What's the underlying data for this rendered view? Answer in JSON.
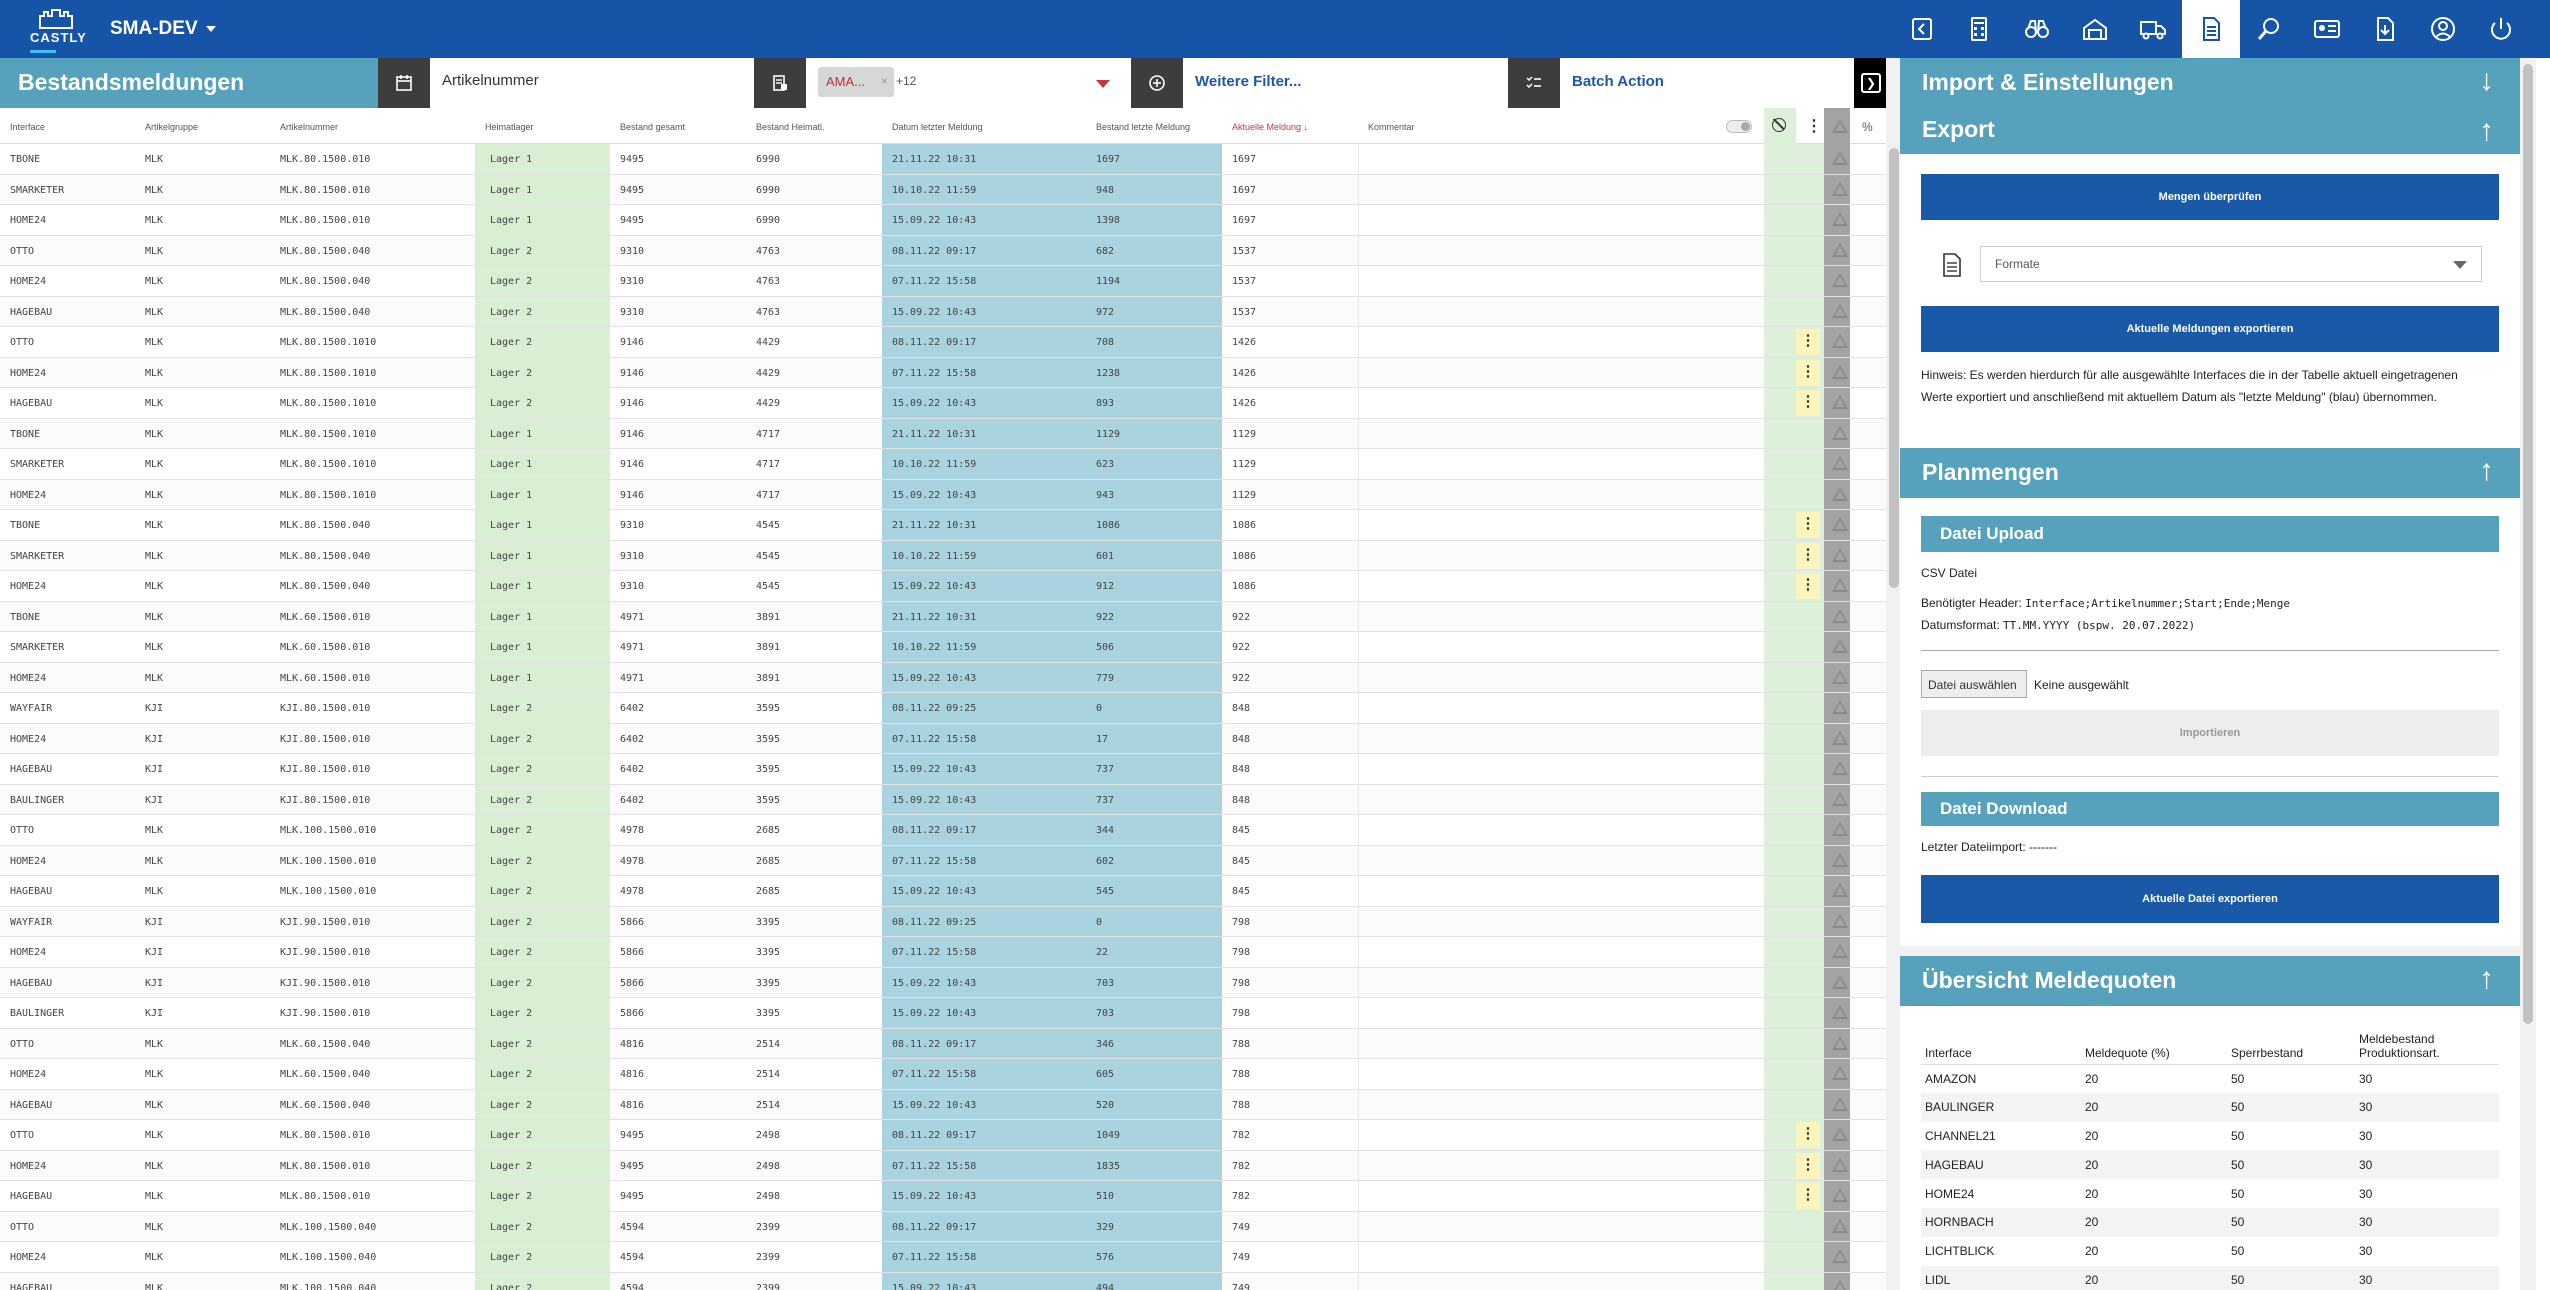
{
  "app": {
    "logo_text": "CASTLY",
    "name": "SMA-DEV"
  },
  "nav_icons": [
    "sign-out-left-icon",
    "calculator-icon",
    "binoculars-icon",
    "warehouse-icon",
    "truck-icon",
    "document-icon",
    "search-zoom-icon",
    "id-card-icon",
    "document-download-icon",
    "user-icon",
    "power-icon"
  ],
  "toolbar": {
    "title": "Bestandsmeldungen",
    "article_placeholder": "Artikelnummer",
    "chip_label": "AMA...",
    "chip_remove": "×",
    "chip_more": "+12",
    "more_filters": "Weitere Filter...",
    "batch_action": "Batch Action"
  },
  "columns": {
    "interface": "Interface",
    "group": "Artikelgruppe",
    "article": "Artikelnummer",
    "lager": "Heimatlager",
    "stock_total": "Bestand gesamt",
    "stock_home": "Bestand Heimatl.",
    "last_date": "Datum letzter Meldung",
    "last_stock": "Bestand letzte Meldung",
    "current": "Aktuelle Meldung ↓",
    "comment": "Kommentar",
    "percent": "%"
  },
  "rows": [
    {
      "i": "TBONE",
      "g": "MLK",
      "a": "MLK.80.1500.010",
      "l": "Lager 1",
      "t": "9495",
      "h": "6990",
      "d": "21.11.22 10:31",
      "s": "1697",
      "c": "1697",
      "dots": false
    },
    {
      "i": "SMARKETER",
      "g": "MLK",
      "a": "MLK.80.1500.010",
      "l": "Lager 1",
      "t": "9495",
      "h": "6990",
      "d": "10.10.22 11:59",
      "s": "948",
      "c": "1697",
      "dots": false
    },
    {
      "i": "HOME24",
      "g": "MLK",
      "a": "MLK.80.1500.010",
      "l": "Lager 1",
      "t": "9495",
      "h": "6990",
      "d": "15.09.22 10:43",
      "s": "1398",
      "c": "1697",
      "dots": false
    },
    {
      "i": "OTTO",
      "g": "MLK",
      "a": "MLK.80.1500.040",
      "l": "Lager 2",
      "t": "9310",
      "h": "4763",
      "d": "08.11.22 09:17",
      "s": "682",
      "c": "1537",
      "dots": false
    },
    {
      "i": "HOME24",
      "g": "MLK",
      "a": "MLK.80.1500.040",
      "l": "Lager 2",
      "t": "9310",
      "h": "4763",
      "d": "07.11.22 15:58",
      "s": "1194",
      "c": "1537",
      "dots": false
    },
    {
      "i": "HAGEBAU",
      "g": "MLK",
      "a": "MLK.80.1500.040",
      "l": "Lager 2",
      "t": "9310",
      "h": "4763",
      "d": "15.09.22 10:43",
      "s": "972",
      "c": "1537",
      "dots": false
    },
    {
      "i": "OTTO",
      "g": "MLK",
      "a": "MLK.80.1500.1010",
      "l": "Lager 2",
      "t": "9146",
      "h": "4429",
      "d": "08.11.22 09:17",
      "s": "708",
      "c": "1426",
      "dots": true
    },
    {
      "i": "HOME24",
      "g": "MLK",
      "a": "MLK.80.1500.1010",
      "l": "Lager 2",
      "t": "9146",
      "h": "4429",
      "d": "07.11.22 15:58",
      "s": "1238",
      "c": "1426",
      "dots": true
    },
    {
      "i": "HAGEBAU",
      "g": "MLK",
      "a": "MLK.80.1500.1010",
      "l": "Lager 2",
      "t": "9146",
      "h": "4429",
      "d": "15.09.22 10:43",
      "s": "893",
      "c": "1426",
      "dots": true
    },
    {
      "i": "TBONE",
      "g": "MLK",
      "a": "MLK.80.1500.1010",
      "l": "Lager 1",
      "t": "9146",
      "h": "4717",
      "d": "21.11.22 10:31",
      "s": "1129",
      "c": "1129",
      "dots": false
    },
    {
      "i": "SMARKETER",
      "g": "MLK",
      "a": "MLK.80.1500.1010",
      "l": "Lager 1",
      "t": "9146",
      "h": "4717",
      "d": "10.10.22 11:59",
      "s": "623",
      "c": "1129",
      "dots": false
    },
    {
      "i": "HOME24",
      "g": "MLK",
      "a": "MLK.80.1500.1010",
      "l": "Lager 1",
      "t": "9146",
      "h": "4717",
      "d": "15.09.22 10:43",
      "s": "943",
      "c": "1129",
      "dots": false
    },
    {
      "i": "TBONE",
      "g": "MLK",
      "a": "MLK.80.1500.040",
      "l": "Lager 1",
      "t": "9310",
      "h": "4545",
      "d": "21.11.22 10:31",
      "s": "1086",
      "c": "1086",
      "dots": true
    },
    {
      "i": "SMARKETER",
      "g": "MLK",
      "a": "MLK.80.1500.040",
      "l": "Lager 1",
      "t": "9310",
      "h": "4545",
      "d": "10.10.22 11:59",
      "s": "601",
      "c": "1086",
      "dots": true
    },
    {
      "i": "HOME24",
      "g": "MLK",
      "a": "MLK.80.1500.040",
      "l": "Lager 1",
      "t": "9310",
      "h": "4545",
      "d": "15.09.22 10:43",
      "s": "912",
      "c": "1086",
      "dots": true
    },
    {
      "i": "TBONE",
      "g": "MLK",
      "a": "MLK.60.1500.010",
      "l": "Lager 1",
      "t": "4971",
      "h": "3891",
      "d": "21.11.22 10:31",
      "s": "922",
      "c": "922",
      "dots": false
    },
    {
      "i": "SMARKETER",
      "g": "MLK",
      "a": "MLK.60.1500.010",
      "l": "Lager 1",
      "t": "4971",
      "h": "3891",
      "d": "10.10.22 11:59",
      "s": "506",
      "c": "922",
      "dots": false
    },
    {
      "i": "HOME24",
      "g": "MLK",
      "a": "MLK.60.1500.010",
      "l": "Lager 1",
      "t": "4971",
      "h": "3891",
      "d": "15.09.22 10:43",
      "s": "779",
      "c": "922",
      "dots": false
    },
    {
      "i": "WAYFAIR",
      "g": "KJI",
      "a": "KJI.80.1500.010",
      "l": "Lager 2",
      "t": "6402",
      "h": "3595",
      "d": "08.11.22 09:25",
      "s": "0",
      "c": "848",
      "dots": false
    },
    {
      "i": "HOME24",
      "g": "KJI",
      "a": "KJI.80.1500.010",
      "l": "Lager 2",
      "t": "6402",
      "h": "3595",
      "d": "07.11.22 15:58",
      "s": "17",
      "c": "848",
      "dots": false
    },
    {
      "i": "HAGEBAU",
      "g": "KJI",
      "a": "KJI.80.1500.010",
      "l": "Lager 2",
      "t": "6402",
      "h": "3595",
      "d": "15.09.22 10:43",
      "s": "737",
      "c": "848",
      "dots": false
    },
    {
      "i": "BAULINGER",
      "g": "KJI",
      "a": "KJI.80.1500.010",
      "l": "Lager 2",
      "t": "6402",
      "h": "3595",
      "d": "15.09.22 10:43",
      "s": "737",
      "c": "848",
      "dots": false
    },
    {
      "i": "OTTO",
      "g": "MLK",
      "a": "MLK.100.1500.010",
      "l": "Lager 2",
      "t": "4978",
      "h": "2685",
      "d": "08.11.22 09:17",
      "s": "344",
      "c": "845",
      "dots": false
    },
    {
      "i": "HOME24",
      "g": "MLK",
      "a": "MLK.100.1500.010",
      "l": "Lager 2",
      "t": "4978",
      "h": "2685",
      "d": "07.11.22 15:58",
      "s": "602",
      "c": "845",
      "dots": false
    },
    {
      "i": "HAGEBAU",
      "g": "MLK",
      "a": "MLK.100.1500.010",
      "l": "Lager 2",
      "t": "4978",
      "h": "2685",
      "d": "15.09.22 10:43",
      "s": "545",
      "c": "845",
      "dots": false
    },
    {
      "i": "WAYFAIR",
      "g": "KJI",
      "a": "KJI.90.1500.010",
      "l": "Lager 2",
      "t": "5866",
      "h": "3395",
      "d": "08.11.22 09:25",
      "s": "0",
      "c": "798",
      "dots": false
    },
    {
      "i": "HOME24",
      "g": "KJI",
      "a": "KJI.90.1500.010",
      "l": "Lager 2",
      "t": "5866",
      "h": "3395",
      "d": "07.11.22 15:58",
      "s": "22",
      "c": "798",
      "dots": false
    },
    {
      "i": "HAGEBAU",
      "g": "KJI",
      "a": "KJI.90.1500.010",
      "l": "Lager 2",
      "t": "5866",
      "h": "3395",
      "d": "15.09.22 10:43",
      "s": "703",
      "c": "798",
      "dots": false
    },
    {
      "i": "BAULINGER",
      "g": "KJI",
      "a": "KJI.90.1500.010",
      "l": "Lager 2",
      "t": "5866",
      "h": "3395",
      "d": "15.09.22 10:43",
      "s": "703",
      "c": "798",
      "dots": false
    },
    {
      "i": "OTTO",
      "g": "MLK",
      "a": "MLK.60.1500.040",
      "l": "Lager 2",
      "t": "4816",
      "h": "2514",
      "d": "08.11.22 09:17",
      "s": "346",
      "c": "788",
      "dots": false
    },
    {
      "i": "HOME24",
      "g": "MLK",
      "a": "MLK.60.1500.040",
      "l": "Lager 2",
      "t": "4816",
      "h": "2514",
      "d": "07.11.22 15:58",
      "s": "605",
      "c": "788",
      "dots": false
    },
    {
      "i": "HAGEBAU",
      "g": "MLK",
      "a": "MLK.60.1500.040",
      "l": "Lager 2",
      "t": "4816",
      "h": "2514",
      "d": "15.09.22 10:43",
      "s": "520",
      "c": "788",
      "dots": false
    },
    {
      "i": "OTTO",
      "g": "MLK",
      "a": "MLK.80.1500.010",
      "l": "Lager 2",
      "t": "9495",
      "h": "2498",
      "d": "08.11.22 09:17",
      "s": "1049",
      "c": "782",
      "dots": true
    },
    {
      "i": "HOME24",
      "g": "MLK",
      "a": "MLK.80.1500.010",
      "l": "Lager 2",
      "t": "9495",
      "h": "2498",
      "d": "07.11.22 15:58",
      "s": "1835",
      "c": "782",
      "dots": true
    },
    {
      "i": "HAGEBAU",
      "g": "MLK",
      "a": "MLK.80.1500.010",
      "l": "Lager 2",
      "t": "9495",
      "h": "2498",
      "d": "15.09.22 10:43",
      "s": "510",
      "c": "782",
      "dots": true
    },
    {
      "i": "OTTO",
      "g": "MLK",
      "a": "MLK.100.1500.040",
      "l": "Lager 2",
      "t": "4594",
      "h": "2399",
      "d": "08.11.22 09:17",
      "s": "329",
      "c": "749",
      "dots": false
    },
    {
      "i": "HOME24",
      "g": "MLK",
      "a": "MLK.100.1500.040",
      "l": "Lager 2",
      "t": "4594",
      "h": "2399",
      "d": "07.11.22 15:58",
      "s": "576",
      "c": "749",
      "dots": false
    },
    {
      "i": "HAGEBAU",
      "g": "MLK",
      "a": "MLK.100.1500.040",
      "l": "Lager 2",
      "t": "4594",
      "h": "2399",
      "d": "15.09.22 10:43",
      "s": "494",
      "c": "749",
      "dots": false
    }
  ],
  "panel": {
    "title": "Import & Einstellungen",
    "export": {
      "title": "Export",
      "check_button": "Mengen überprüfen",
      "format_placeholder": "Formate",
      "export_button": "Aktuelle Meldungen exportieren",
      "hint_line1": "Hinweis: Es werden hierdurch für alle ausgewählte Interfaces die in der Tabelle aktuell eingetragenen",
      "hint_line2": "Werte exportiert und anschließend mit aktuellem Datum als \"letzte Meldung\" (blau) übernommen."
    },
    "plan": {
      "title": "Planmengen",
      "upload_title": "Datei Upload",
      "csv_label": "CSV Datei",
      "header_label": "Benötigter Header:",
      "header_value": "Interface;Artikelnummer;Start;Ende;Menge",
      "date_label": "Datumsformat:",
      "date_value": "TT.MM.YYYY (bspw. 20.07.2022)",
      "file_button": "Datei auswählen",
      "file_status": "Keine ausgewählt",
      "import_button": "Importieren",
      "download_title": "Datei Download",
      "last_import": "Letzter Dateiimport: -------",
      "export_file_button": "Aktuelle Datei exportieren"
    },
    "quota": {
      "title": "Übersicht Meldequoten",
      "headers": [
        "Interface",
        "Meldequote (%)",
        "Sperrbestand",
        "Meldebestand Produktionsart."
      ],
      "rows": [
        [
          "AMAZON",
          "20",
          "50",
          "30"
        ],
        [
          "BAULINGER",
          "20",
          "50",
          "30"
        ],
        [
          "CHANNEL21",
          "20",
          "50",
          "30"
        ],
        [
          "HAGEBAU",
          "20",
          "50",
          "30"
        ],
        [
          "HOME24",
          "20",
          "50",
          "30"
        ],
        [
          "HORNBACH",
          "20",
          "50",
          "30"
        ],
        [
          "LICHTBLICK",
          "20",
          "50",
          "30"
        ],
        [
          "LIDL",
          "20",
          "50",
          "30"
        ]
      ]
    }
  }
}
